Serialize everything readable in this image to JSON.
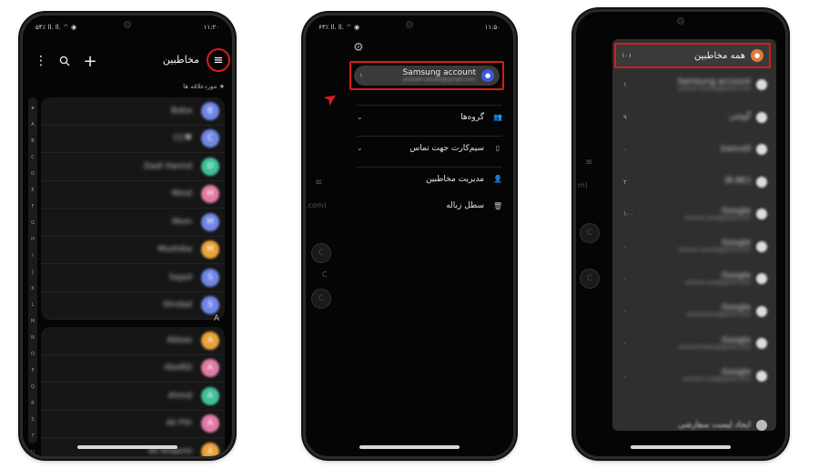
{
  "phone1": {
    "status_left": "۱۱:۲۰",
    "status_right": "۵۴٪ ll. ll. ⌔ ◉",
    "title": "مخاطبین",
    "menu_icon": "hamburger-menu-icon",
    "favorites_header": "★ موردعلاقه ها",
    "index_letters": [
      "★",
      "A",
      "B",
      "C",
      "D",
      "E",
      "F",
      "G",
      "H",
      "I",
      "J",
      "K",
      "L",
      "M",
      "N",
      "O",
      "P",
      "Q",
      "R",
      "S",
      "T",
      "U",
      "V"
    ],
    "favorites": [
      {
        "name": "Baba",
        "initial": "B",
        "color": "#6f86e6"
      },
      {
        "name": "CC♥",
        "initial": "C",
        "color": "#6f86e6"
      },
      {
        "name": "Dadi Hamid",
        "initial": "D",
        "color": "#3fbf9a"
      },
      {
        "name": "Mmd",
        "initial": "M",
        "color": "#e07aa5"
      },
      {
        "name": "Mom",
        "initial": "M",
        "color": "#6f86e6"
      },
      {
        "name": "Mozhiba",
        "initial": "M",
        "color": "#e8a23a"
      },
      {
        "name": "Sajad",
        "initial": "S",
        "color": "#6f86e6"
      },
      {
        "name": "Shrdad",
        "initial": "S",
        "color": "#6f86e6"
      }
    ],
    "section_a_label": "A",
    "section_a": [
      {
        "name": "Abbas",
        "initial": "A",
        "color": "#e8a23a"
      },
      {
        "name": "AboRD",
        "initial": "A",
        "color": "#e07aa5"
      },
      {
        "name": "Ahmd",
        "initial": "A",
        "color": "#3fbf9a"
      },
      {
        "name": "Ali Fth",
        "initial": "A",
        "color": "#e07aa5"
      },
      {
        "name": "Ali Khaemi",
        "initial": "A",
        "color": "#e8a23a"
      }
    ]
  },
  "phone2": {
    "status_left": "۱۱:۵۰",
    "status_right": "۶۳٪ ll. ll. ⌔ ◉",
    "samsung_account": {
      "label": "Samsung account",
      "sub": "arsham.sou93@gmail.com",
      "count": "۱"
    },
    "items": [
      {
        "label": "گروه‌ها",
        "icon": "groups-icon",
        "chevron": true
      },
      {
        "label": "سیم‌کارت جهت تماس",
        "icon": "sim-icon",
        "chevron": true
      },
      {
        "label": "مدیریت مخاطبین",
        "icon": "manage-contacts-icon",
        "chevron": false
      },
      {
        "label": "سطل زباله",
        "icon": "trash-icon",
        "chevron": false
      }
    ],
    "behind_text": ".com)",
    "behind_initials": [
      "C",
      "C",
      "C"
    ]
  },
  "phone3": {
    "all_contacts": {
      "label": "همه مخاطبین",
      "count": "۱۰۱"
    },
    "accounts": [
      {
        "count": "۱",
        "t1": "Samsung account",
        "t2": "arsham.sou93@gmail.com"
      },
      {
        "count": "۹",
        "t1": "گوشی",
        "t2": ""
      },
      {
        "count": "۰",
        "t1": "Irancell",
        "t2": ""
      },
      {
        "count": "۲",
        "t1": "IR-MCI",
        "t2": ""
      },
      {
        "count": "۱۰۰",
        "t1": "Google",
        "t2": "arsham.sou@gmail.com"
      },
      {
        "count": "۰",
        "t1": "Google",
        "t2": "arsham.sou93@gmail.com"
      },
      {
        "count": "۰",
        "t1": "Google",
        "t2": "arsham.sou@gmail.com"
      },
      {
        "count": "۰",
        "t1": "Google",
        "t2": "arshamsou@gmail.com"
      },
      {
        "count": "۰",
        "t1": "Google",
        "t2": "arshamholans@gmail.com"
      },
      {
        "count": "۰",
        "t1": "Google",
        "t2": "arsham.n.sb@gmail.com"
      }
    ],
    "create_list": "ایجاد لیست سفارشی",
    "behind_text": "m)",
    "behind_initials": [
      "C",
      "C"
    ]
  }
}
